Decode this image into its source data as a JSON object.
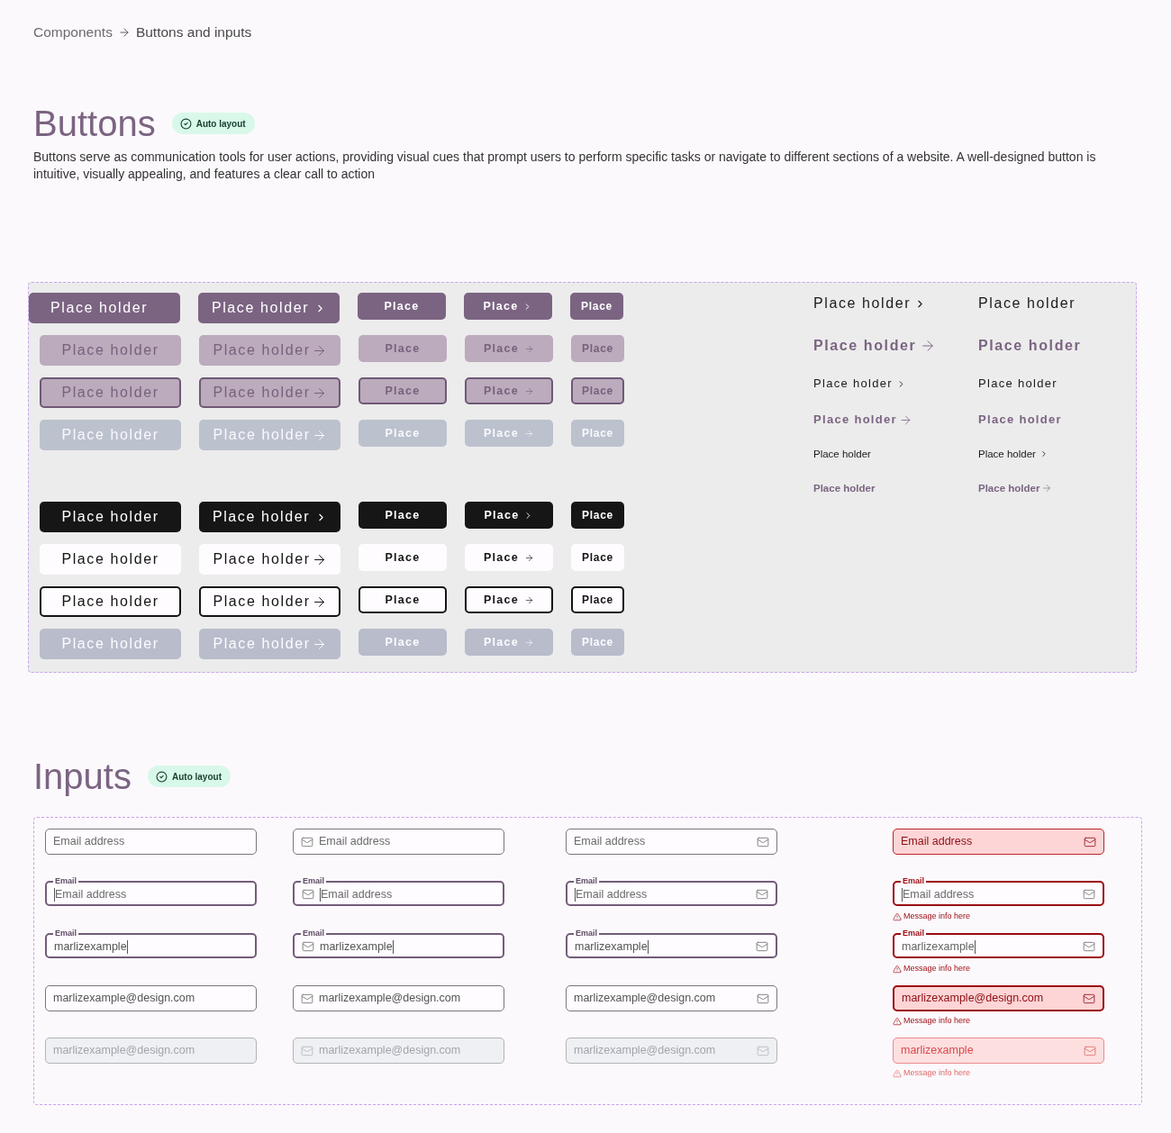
{
  "breadcrumb": {
    "items": [
      "Components",
      "Buttons and inputs"
    ]
  },
  "buttons_section": {
    "title": "Buttons",
    "badge": "Auto layout",
    "description": "Buttons serve as communication tools for user actions, providing visual cues that prompt users to perform specific tasks or navigate to different sections of a website. A well-designed button is intuitive, visually appealing, and features a clear call to action",
    "groups": [
      {
        "rows": [
          {
            "kind": "primary",
            "buttons": [
              {
                "label": "Place holder",
                "kind": "wide"
              },
              {
                "label": "Place holder",
                "kind": "chevron"
              },
              {
                "label": "Place",
                "kind": "plain"
              },
              {
                "label": "Place",
                "kind": "chevron"
              },
              {
                "label": "Place",
                "kind": "plain"
              }
            ]
          },
          {
            "kind": "tinted",
            "buttons": [
              {
                "label": "Place holder",
                "kind": "plain"
              },
              {
                "label": "Place holder",
                "kind": "arrow"
              },
              {
                "label": "Place",
                "kind": "plain"
              },
              {
                "label": "Place",
                "kind": "arrow"
              },
              {
                "label": "Place",
                "kind": "plain"
              }
            ]
          },
          {
            "kind": "tinted-outline",
            "buttons": [
              {
                "label": "Place holder",
                "kind": "plain"
              },
              {
                "label": "Place holder",
                "kind": "arrow"
              },
              {
                "label": "Place",
                "kind": "plain"
              },
              {
                "label": "Place",
                "kind": "arrow"
              },
              {
                "label": "Place",
                "kind": "plain"
              }
            ]
          },
          {
            "kind": "muted",
            "buttons": [
              {
                "label": "Place holder",
                "kind": "plain"
              },
              {
                "label": "Place holder",
                "kind": "arrow"
              },
              {
                "label": "Place",
                "kind": "plain"
              },
              {
                "label": "Place",
                "kind": "arrow"
              },
              {
                "label": "Place",
                "kind": "plain"
              }
            ]
          }
        ]
      },
      {
        "rows": [
          {
            "kind": "dark",
            "buttons": [
              {
                "label": "Place holder",
                "kind": "plain"
              },
              {
                "label": "Place holder",
                "kind": "chevron"
              },
              {
                "label": "Place",
                "kind": "plain"
              },
              {
                "label": "Place",
                "kind": "chevron"
              },
              {
                "label": "Place",
                "kind": "plain"
              }
            ]
          },
          {
            "kind": "light",
            "buttons": [
              {
                "label": "Place holder",
                "kind": "plain"
              },
              {
                "label": "Place holder",
                "kind": "arrow"
              },
              {
                "label": "Place",
                "kind": "plain"
              },
              {
                "label": "Place",
                "kind": "arrow"
              },
              {
                "label": "Place",
                "kind": "plain"
              }
            ]
          },
          {
            "kind": "dark-outline",
            "buttons": [
              {
                "label": "Place holder",
                "kind": "plain"
              },
              {
                "label": "Place holder",
                "kind": "arrow"
              },
              {
                "label": "Place",
                "kind": "plain"
              },
              {
                "label": "Place",
                "kind": "arrow"
              },
              {
                "label": "Place",
                "kind": "plain"
              }
            ]
          },
          {
            "kind": "disabled",
            "buttons": [
              {
                "label": "Place holder",
                "kind": "plain"
              },
              {
                "label": "Place holder",
                "kind": "arrow"
              },
              {
                "label": "Place",
                "kind": "plain"
              },
              {
                "label": "Place",
                "kind": "arrow"
              },
              {
                "label": "Place",
                "kind": "plain"
              }
            ]
          }
        ]
      }
    ],
    "link_rows": [
      {
        "kind": "large",
        "links": [
          {
            "label": "Place holder",
            "kind": "chevron"
          },
          {
            "label": "Place holder",
            "kind": "plain"
          }
        ]
      },
      {
        "kind": "large-accent",
        "links": [
          {
            "label": "Place holder",
            "kind": "arrow"
          },
          {
            "label": "Place holder",
            "kind": "plain"
          }
        ]
      },
      {
        "kind": "medium",
        "links": [
          {
            "label": "Place holder",
            "kind": "chevron"
          },
          {
            "label": "Place holder",
            "kind": "plain"
          }
        ]
      },
      {
        "kind": "medium-accent",
        "links": [
          {
            "label": "Place holder",
            "kind": "arrow"
          },
          {
            "label": "Place holder",
            "kind": "plain"
          }
        ]
      },
      {
        "kind": "small",
        "links": [
          {
            "label": "Place holder",
            "kind": "plain"
          },
          {
            "label": "Place holder",
            "kind": "chevron"
          }
        ]
      },
      {
        "kind": "small-accent",
        "links": [
          {
            "label": "Place holder",
            "kind": "plain"
          },
          {
            "label": "Place holder",
            "kind": "arrow"
          }
        ]
      }
    ]
  },
  "inputs_section": {
    "title": "Inputs",
    "badge": "Auto layout",
    "columns": [
      {
        "kind": "plain",
        "error": false,
        "fields": [
          {
            "placeholder": "Email address",
            "focused": false,
            "disabled": false
          },
          {
            "label": "Email",
            "placeholder": "Email address",
            "focused": true,
            "disabled": false
          },
          {
            "label": "Email",
            "value": "marlizexample",
            "focused": true,
            "disabled": false
          },
          {
            "value": "marlizexample@design.com",
            "focused": false,
            "disabled": false
          },
          {
            "value": "marlizexample@design.com",
            "focused": false,
            "disabled": true
          }
        ]
      },
      {
        "kind": "leading-icon",
        "error": false,
        "fields": [
          {
            "placeholder": "Email address",
            "focused": false,
            "disabled": false
          },
          {
            "label": "Email",
            "placeholder": "Email address",
            "focused": true,
            "disabled": false
          },
          {
            "label": "Email",
            "value": "marlizexample",
            "focused": true,
            "disabled": false
          },
          {
            "value": "marlizexample@design.com",
            "focused": false,
            "disabled": false
          },
          {
            "value": "marlizexample@design.com",
            "focused": false,
            "disabled": true
          }
        ]
      },
      {
        "kind": "trailing-icon",
        "error": false,
        "fields": [
          {
            "placeholder": "Email address",
            "focused": false,
            "disabled": false
          },
          {
            "label": "Email",
            "placeholder": "Email address",
            "focused": true,
            "disabled": false
          },
          {
            "label": "Email",
            "value": "marlizexample",
            "focused": true,
            "disabled": false
          },
          {
            "value": "marlizexample@design.com",
            "focused": false,
            "disabled": false
          },
          {
            "value": "marlizexample@design.com",
            "focused": false,
            "disabled": true
          }
        ]
      },
      {
        "kind": "trailing-icon",
        "error": true,
        "fields": [
          {
            "placeholder": "Email address",
            "focused": false,
            "disabled": false
          },
          {
            "label": "Email",
            "placeholder": "Email address",
            "focused": true,
            "disabled": false,
            "message": "Message info here"
          },
          {
            "label": "Email",
            "value": "marlizexample",
            "focused": true,
            "disabled": false,
            "message": "Message info here"
          },
          {
            "value": "marlizexample@design.com",
            "focused": false,
            "disabled": false,
            "message": "Message info here"
          },
          {
            "value": "marlizexample",
            "focused": false,
            "disabled": true,
            "message": "Message info here"
          }
        ]
      }
    ]
  }
}
